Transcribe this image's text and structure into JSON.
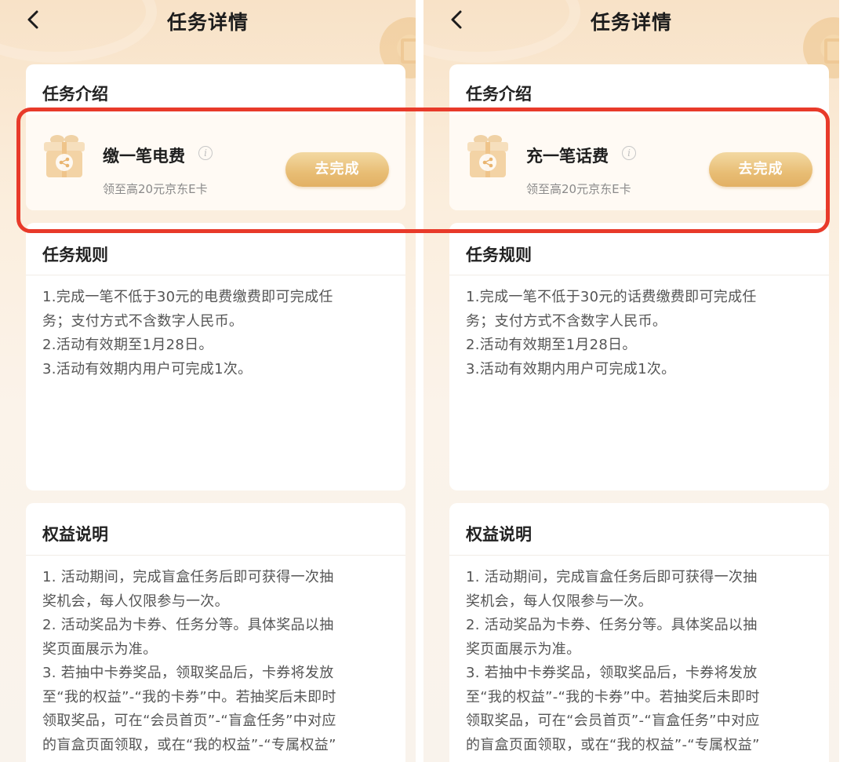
{
  "colors": {
    "accent": "#e8bd74",
    "highlight": "#e83a2a",
    "background": "#f8e2c7"
  },
  "panels": [
    {
      "nav_title": "任务详情",
      "intro_title": "任务介绍",
      "task_name": "缴一笔电费",
      "task_reward": "领至高20元京东E卡",
      "go_button": "去完成",
      "info_icon": "i",
      "rules_title": "任务规则",
      "rules": [
        "1.完成一笔不低于30元的电费缴费即可完成任",
        "务；支付方式不含数字人民币。",
        "2.活动有效期至1月28日。",
        "3.活动有效期内用户可完成1次。"
      ],
      "rights_title": "权益说明",
      "rights": [
        "1. 活动期间，完成盲盒任务后即可获得一次抽",
        "奖机会，每人仅限参与一次。",
        "2. 活动奖品为卡券、任务分等。具体奖品以抽",
        "奖页面展示为准。",
        "3. 若抽中卡券奖品，领取奖品后，卡券将发放",
        "至“我的权益”-“我的卡券”中。若抽奖后未即时",
        "领取奖品，可在“会员首页”-“盲盒任务”中对应",
        "的盲盒页面领取，或在“我的权益”-“专属权益”"
      ]
    },
    {
      "nav_title": "任务详情",
      "intro_title": "任务介绍",
      "task_name": "充一笔话费",
      "task_reward": "领至高20元京东E卡",
      "go_button": "去完成",
      "info_icon": "i",
      "rules_title": "任务规则",
      "rules": [
        "1.完成一笔不低于30元的话费缴费即可完成任",
        "务；支付方式不含数字人民币。",
        "2.活动有效期至1月28日。",
        "3.活动有效期内用户可完成1次。"
      ],
      "rights_title": "权益说明",
      "rights": [
        "1. 活动期间，完成盲盒任务后即可获得一次抽",
        "奖机会，每人仅限参与一次。",
        "2. 活动奖品为卡券、任务分等。具体奖品以抽",
        "奖页面展示为准。",
        "3. 若抽中卡券奖品，领取奖品后，卡券将发放",
        "至“我的权益”-“我的卡券”中。若抽奖后未即时",
        "领取奖品，可在“会员首页”-“盲盒任务”中对应",
        "的盲盒页面领取，或在“我的权益”-“专属权益”"
      ]
    }
  ]
}
